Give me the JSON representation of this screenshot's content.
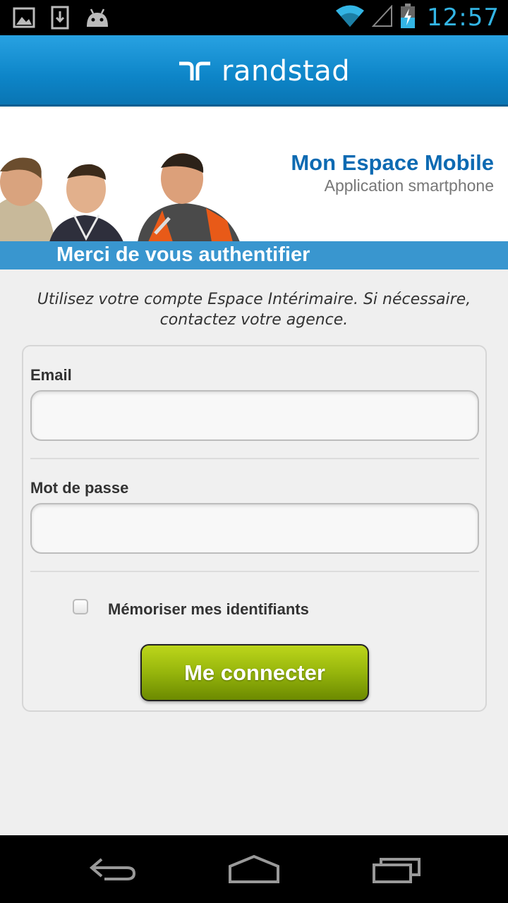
{
  "status_bar": {
    "time": "12:57",
    "icons": [
      "image-notification-icon",
      "download-notification-icon",
      "android-notification-icon",
      "wifi-icon",
      "signal-icon",
      "battery-charging-icon"
    ]
  },
  "header": {
    "logo_text": "randstad"
  },
  "banner": {
    "title": "Mon Espace Mobile",
    "subtitle": "Application smartphone"
  },
  "auth_title": "Merci de vous authentifier",
  "intro_line1": "Utilisez votre compte Espace Intérimaire. Si nécessaire,",
  "intro_line2": "contactez votre agence.",
  "form": {
    "email_label": "Email",
    "email_value": "",
    "password_label": "Mot de passe",
    "password_value": "",
    "remember_label": "Mémoriser mes identifiants",
    "remember_checked": false,
    "submit_label": "Me connecter"
  },
  "nav_bar": {
    "icons": [
      "back-icon",
      "home-icon",
      "recent-apps-icon"
    ]
  },
  "colors": {
    "accent": "#0d6ab2",
    "header_blue": "#0d85c8",
    "button_green": "#96b50c",
    "status_time": "#33b5e5"
  }
}
